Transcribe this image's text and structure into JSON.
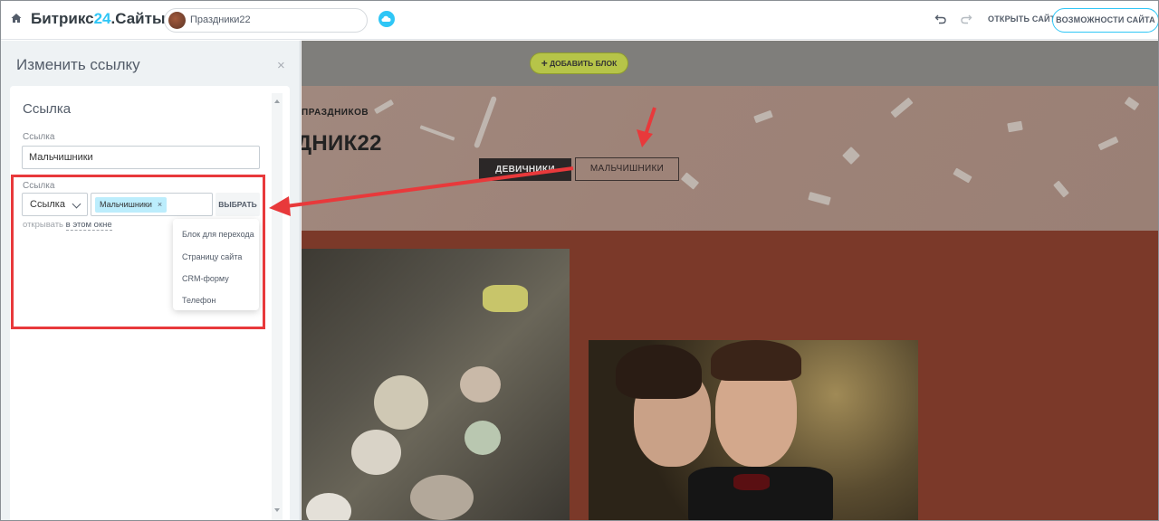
{
  "topbar": {
    "logo_main": "Битрикс",
    "logo_num": "24",
    "logo_suffix": ".Сайты",
    "site_name": "Праздники22",
    "open_site": "ОТКРЫТЬ САЙТ",
    "features": "ВОЗМОЖНОСТИ САЙТА",
    "icons": [
      "home-icon",
      "cloud-icon",
      "undo-icon",
      "redo-icon"
    ]
  },
  "panel": {
    "title": "Изменить ссылку",
    "close": "×",
    "section_title": "Ссылка",
    "text_label": "Ссылка",
    "text_value": "Мальчишники",
    "link_label": "Ссылка",
    "link_type": "Ссылка",
    "tag": "Мальчишники",
    "tag_remove": "×",
    "choose": "ВЫБРАТЬ",
    "open_prefix": "открывать",
    "open_target": "в этом окне",
    "dropdown": [
      "Блок для перехода",
      "Страницу сайта",
      "CRM-форму",
      "Телефон"
    ]
  },
  "canvas": {
    "add_block": "ДОБАВИТЬ БЛОК",
    "hero_subtitle": "ПРАЗДНИКОВ",
    "hero_title": "ДНИК22",
    "btn_girls": "ДЕВИЧНИКИ",
    "btn_boys": "МАЛЬЧИШНИКИ"
  },
  "colors": {
    "accent": "#2fc6f6",
    "annotation_red": "#e8393b",
    "add_block_green": "#b6c449"
  }
}
